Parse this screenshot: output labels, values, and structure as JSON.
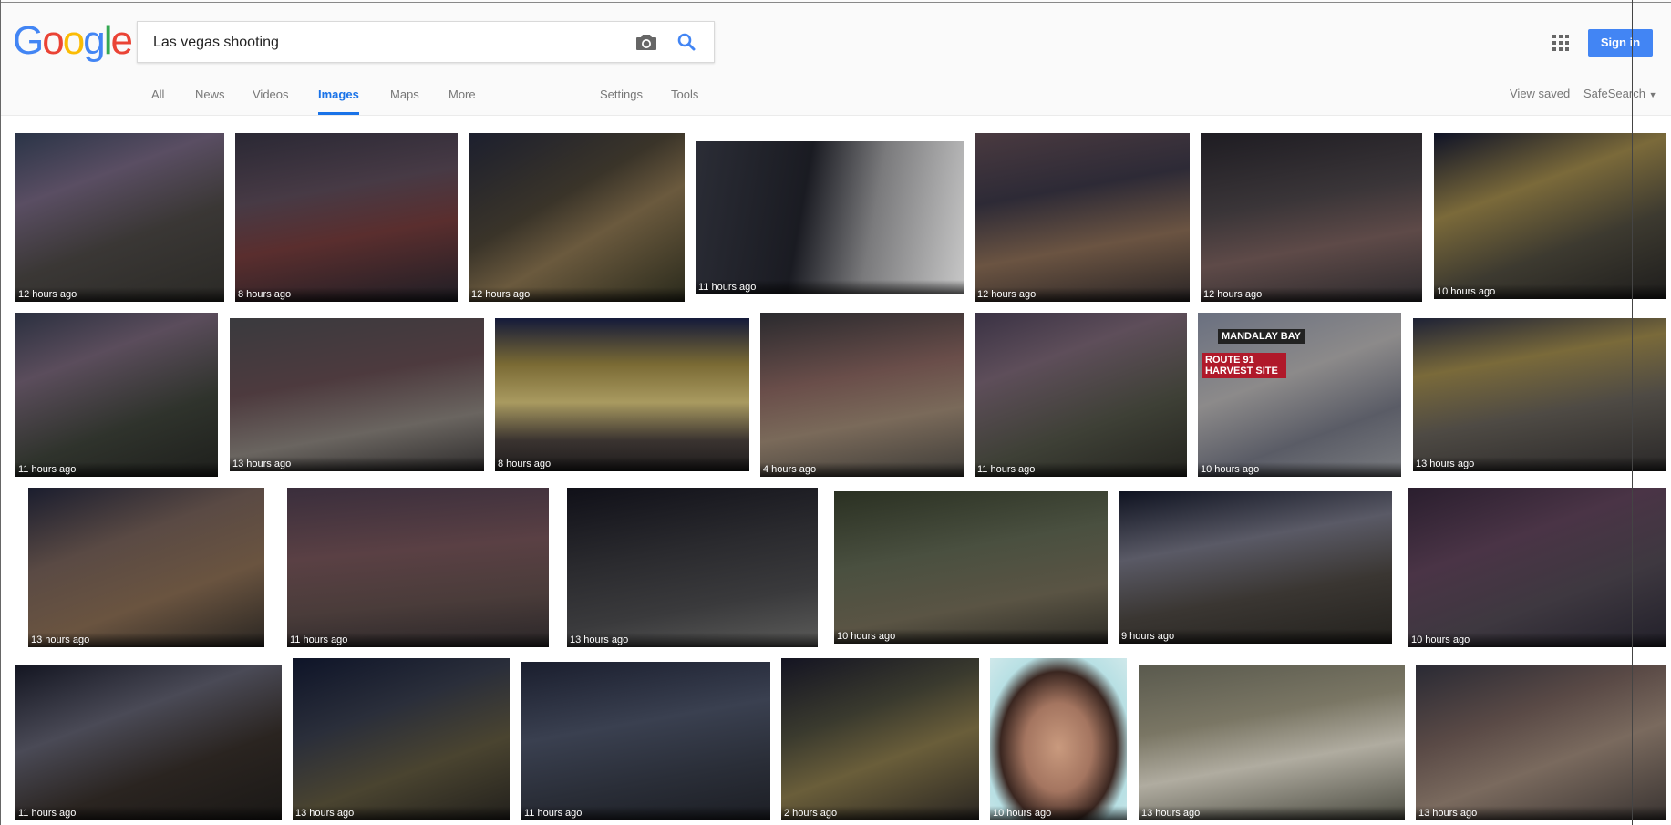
{
  "logo": {
    "letters": [
      "G",
      "o",
      "o",
      "g",
      "l",
      "e"
    ],
    "colors": [
      "#4285f4",
      "#ea4335",
      "#fbbc05",
      "#4285f4",
      "#34a853",
      "#ea4335"
    ]
  },
  "search": {
    "query": "Las vegas shooting"
  },
  "tabs": [
    {
      "label": "All"
    },
    {
      "label": "News"
    },
    {
      "label": "Videos"
    },
    {
      "label": "Images"
    },
    {
      "label": "Maps"
    },
    {
      "label": "More"
    },
    {
      "label": "Settings"
    },
    {
      "label": "Tools"
    }
  ],
  "header": {
    "signin": "Sign in",
    "view_saved": "View saved",
    "safesearch": "SafeSearch"
  },
  "results": [
    {
      "time": "12 hours ago"
    },
    {
      "time": "8 hours ago"
    },
    {
      "time": "12 hours ago"
    },
    {
      "time": "11 hours ago"
    },
    {
      "time": "12 hours ago"
    },
    {
      "time": "12 hours ago"
    },
    {
      "time": "10 hours ago"
    },
    {
      "time": "11 hours ago"
    },
    {
      "time": "13 hours ago"
    },
    {
      "time": "8 hours ago"
    },
    {
      "time": "4 hours ago"
    },
    {
      "time": "11 hours ago"
    },
    {
      "time": "10 hours ago",
      "overlay_top": "MANDALAY BAY",
      "overlay_bottom": "ROUTE 91 HARVEST SITE"
    },
    {
      "time": "13 hours ago"
    },
    {
      "time": "13 hours ago"
    },
    {
      "time": "11 hours ago"
    },
    {
      "time": "13 hours ago"
    },
    {
      "time": "10 hours ago"
    },
    {
      "time": "9 hours ago"
    },
    {
      "time": "10 hours ago"
    },
    {
      "time": "11 hours ago"
    },
    {
      "time": "13 hours ago"
    },
    {
      "time": "11 hours ago"
    },
    {
      "time": "2 hours ago"
    },
    {
      "time": "10 hours ago"
    },
    {
      "time": "13 hours ago"
    }
  ],
  "colors": {
    "accent": "#1a73e8",
    "signin_bg": "#4285f4"
  }
}
